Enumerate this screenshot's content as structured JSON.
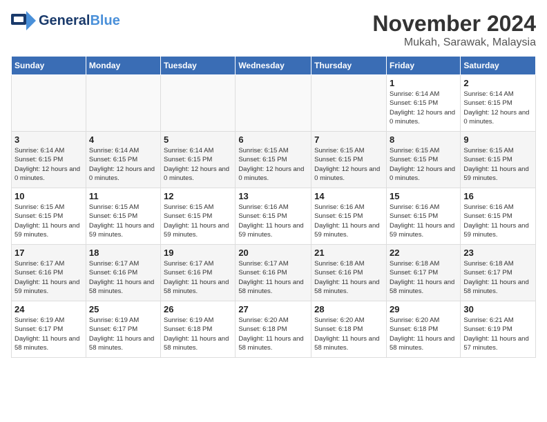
{
  "header": {
    "logo_general": "General",
    "logo_blue": "Blue",
    "month_title": "November 2024",
    "location": "Mukah, Sarawak, Malaysia"
  },
  "days_of_week": [
    "Sunday",
    "Monday",
    "Tuesday",
    "Wednesday",
    "Thursday",
    "Friday",
    "Saturday"
  ],
  "weeks": [
    [
      {
        "day": "",
        "detail": ""
      },
      {
        "day": "",
        "detail": ""
      },
      {
        "day": "",
        "detail": ""
      },
      {
        "day": "",
        "detail": ""
      },
      {
        "day": "",
        "detail": ""
      },
      {
        "day": "1",
        "detail": "Sunrise: 6:14 AM\nSunset: 6:15 PM\nDaylight: 12 hours and 0 minutes."
      },
      {
        "day": "2",
        "detail": "Sunrise: 6:14 AM\nSunset: 6:15 PM\nDaylight: 12 hours and 0 minutes."
      }
    ],
    [
      {
        "day": "3",
        "detail": "Sunrise: 6:14 AM\nSunset: 6:15 PM\nDaylight: 12 hours and 0 minutes."
      },
      {
        "day": "4",
        "detail": "Sunrise: 6:14 AM\nSunset: 6:15 PM\nDaylight: 12 hours and 0 minutes."
      },
      {
        "day": "5",
        "detail": "Sunrise: 6:14 AM\nSunset: 6:15 PM\nDaylight: 12 hours and 0 minutes."
      },
      {
        "day": "6",
        "detail": "Sunrise: 6:15 AM\nSunset: 6:15 PM\nDaylight: 12 hours and 0 minutes."
      },
      {
        "day": "7",
        "detail": "Sunrise: 6:15 AM\nSunset: 6:15 PM\nDaylight: 12 hours and 0 minutes."
      },
      {
        "day": "8",
        "detail": "Sunrise: 6:15 AM\nSunset: 6:15 PM\nDaylight: 12 hours and 0 minutes."
      },
      {
        "day": "9",
        "detail": "Sunrise: 6:15 AM\nSunset: 6:15 PM\nDaylight: 11 hours and 59 minutes."
      }
    ],
    [
      {
        "day": "10",
        "detail": "Sunrise: 6:15 AM\nSunset: 6:15 PM\nDaylight: 11 hours and 59 minutes."
      },
      {
        "day": "11",
        "detail": "Sunrise: 6:15 AM\nSunset: 6:15 PM\nDaylight: 11 hours and 59 minutes."
      },
      {
        "day": "12",
        "detail": "Sunrise: 6:15 AM\nSunset: 6:15 PM\nDaylight: 11 hours and 59 minutes."
      },
      {
        "day": "13",
        "detail": "Sunrise: 6:16 AM\nSunset: 6:15 PM\nDaylight: 11 hours and 59 minutes."
      },
      {
        "day": "14",
        "detail": "Sunrise: 6:16 AM\nSunset: 6:15 PM\nDaylight: 11 hours and 59 minutes."
      },
      {
        "day": "15",
        "detail": "Sunrise: 6:16 AM\nSunset: 6:15 PM\nDaylight: 11 hours and 59 minutes."
      },
      {
        "day": "16",
        "detail": "Sunrise: 6:16 AM\nSunset: 6:15 PM\nDaylight: 11 hours and 59 minutes."
      }
    ],
    [
      {
        "day": "17",
        "detail": "Sunrise: 6:17 AM\nSunset: 6:16 PM\nDaylight: 11 hours and 59 minutes."
      },
      {
        "day": "18",
        "detail": "Sunrise: 6:17 AM\nSunset: 6:16 PM\nDaylight: 11 hours and 58 minutes."
      },
      {
        "day": "19",
        "detail": "Sunrise: 6:17 AM\nSunset: 6:16 PM\nDaylight: 11 hours and 58 minutes."
      },
      {
        "day": "20",
        "detail": "Sunrise: 6:17 AM\nSunset: 6:16 PM\nDaylight: 11 hours and 58 minutes."
      },
      {
        "day": "21",
        "detail": "Sunrise: 6:18 AM\nSunset: 6:16 PM\nDaylight: 11 hours and 58 minutes."
      },
      {
        "day": "22",
        "detail": "Sunrise: 6:18 AM\nSunset: 6:17 PM\nDaylight: 11 hours and 58 minutes."
      },
      {
        "day": "23",
        "detail": "Sunrise: 6:18 AM\nSunset: 6:17 PM\nDaylight: 11 hours and 58 minutes."
      }
    ],
    [
      {
        "day": "24",
        "detail": "Sunrise: 6:19 AM\nSunset: 6:17 PM\nDaylight: 11 hours and 58 minutes."
      },
      {
        "day": "25",
        "detail": "Sunrise: 6:19 AM\nSunset: 6:17 PM\nDaylight: 11 hours and 58 minutes."
      },
      {
        "day": "26",
        "detail": "Sunrise: 6:19 AM\nSunset: 6:18 PM\nDaylight: 11 hours and 58 minutes."
      },
      {
        "day": "27",
        "detail": "Sunrise: 6:20 AM\nSunset: 6:18 PM\nDaylight: 11 hours and 58 minutes."
      },
      {
        "day": "28",
        "detail": "Sunrise: 6:20 AM\nSunset: 6:18 PM\nDaylight: 11 hours and 58 minutes."
      },
      {
        "day": "29",
        "detail": "Sunrise: 6:20 AM\nSunset: 6:18 PM\nDaylight: 11 hours and 58 minutes."
      },
      {
        "day": "30",
        "detail": "Sunrise: 6:21 AM\nSunset: 6:19 PM\nDaylight: 11 hours and 57 minutes."
      }
    ]
  ]
}
